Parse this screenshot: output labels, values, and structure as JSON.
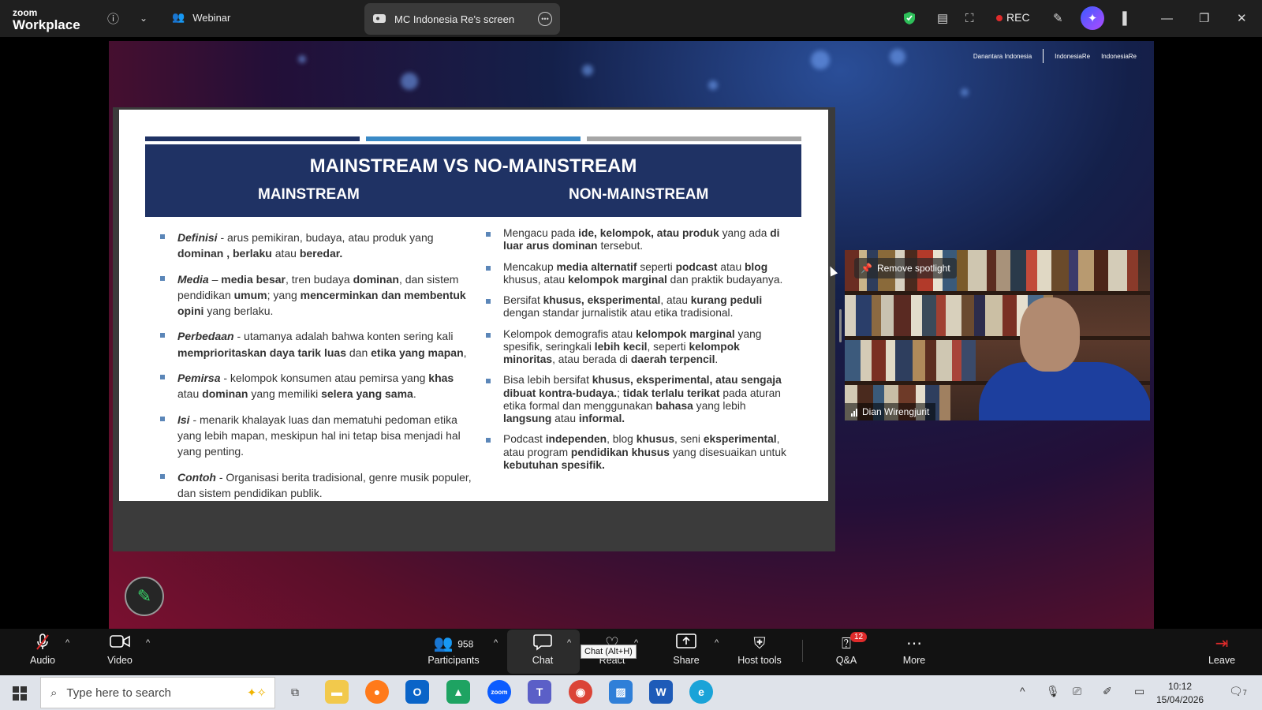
{
  "app": {
    "logo_top": "zoom",
    "logo_bottom": "Workplace"
  },
  "topbar": {
    "webinar_label": "Webinar",
    "share_label": "MC Indonesia Re's screen",
    "rec_label": "REC"
  },
  "slide": {
    "title": "MAINSTREAM VS NO-MAINSTREAM",
    "col1_header": "MAINSTREAM",
    "col2_header": "NON-MAINSTREAM",
    "bar_colors": [
      "#1f3264",
      "#3a8ac6",
      "#a6a6a6"
    ]
  },
  "brands": {
    "b1": "Danantara Indonesia",
    "b2": "IndonesiaRe",
    "b3": "IndonesiaRe"
  },
  "video": {
    "spotlight_label": "Remove spotlight",
    "participant_name": "Dian Wirengjurit"
  },
  "toolbar": {
    "audio": "Audio",
    "video": "Video",
    "participants_count": "958",
    "participants": "Participants",
    "chat": "Chat",
    "chat_tooltip": "Chat (Alt+H)",
    "react": "React",
    "share": "Share",
    "host_tools": "Host tools",
    "qa": "Q&A",
    "qa_badge": "12",
    "more": "More",
    "leave": "Leave"
  },
  "taskbar": {
    "search_placeholder": "Type here to search",
    "time": "10:12",
    "date": "15/04/2026",
    "notif_count": "7"
  },
  "colors": {
    "accent": "#0e72ed",
    "leave_red": "#e02b2b",
    "slide_navy": "#1f3264"
  }
}
